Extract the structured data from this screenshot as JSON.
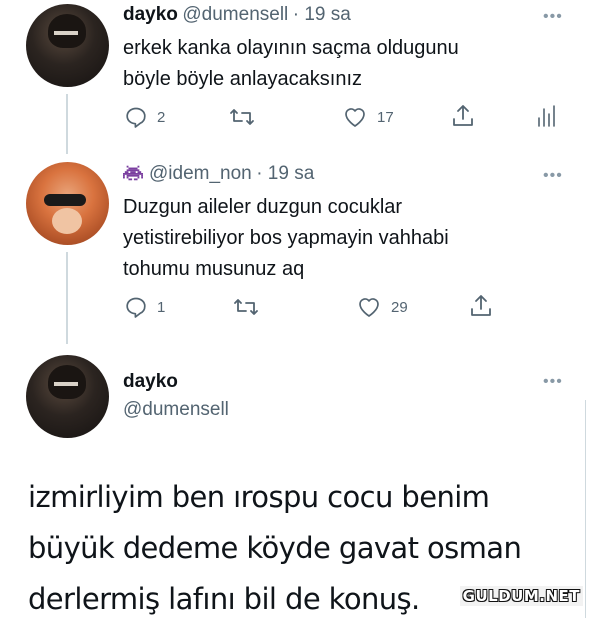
{
  "tweet1": {
    "name": "dayko",
    "handle": "@dumensell",
    "time": "· 19 sa",
    "text_line1": "erkek kanka olayının saçma oldugunu",
    "text_line2": "böyle böyle anlayacaksınız",
    "replies": "2",
    "likes": "17",
    "more": "•••"
  },
  "tweet2": {
    "name_icon": "alien-monster-icon",
    "handle": "@idem_non",
    "time": "· 19 sa",
    "text_line1": "Duzgun aileler duzgun cocuklar",
    "text_line2": "yetistirebiliyor bos yapmayin vahhabi",
    "text_line3": "tohumu musunuz aq",
    "replies": "1",
    "likes": "29",
    "more": "•••"
  },
  "tweet3": {
    "name": "dayko",
    "handle": "@dumensell",
    "text_line1": "izmirliyim ben ırospu cocu benim",
    "text_line2": "büyük dedeme köyde gavat osman",
    "text_line3": "derlermiş lafını bil de konuş.",
    "more": "•••"
  },
  "watermark": "GULDUM.NET",
  "colors": {
    "text": "#0f1419",
    "secondary": "#536471",
    "thread_line": "#cfd9de",
    "alien_purple": "#7b3fa0"
  }
}
